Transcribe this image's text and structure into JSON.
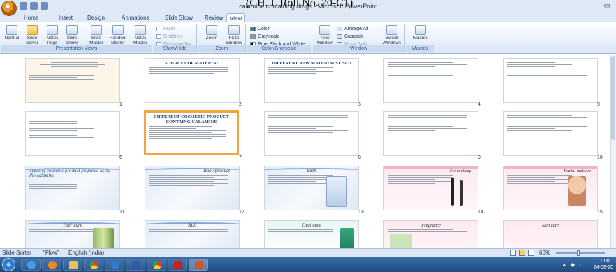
{
  "window": {
    "title": "calamine containing drugs - Microsoft PowerPoint",
    "overlay_caption": "(CH. L Roll No. 20-C1)",
    "minimize": "–",
    "maximize": "▭"
  },
  "tabs": [
    "Home",
    "Insert",
    "Design",
    "Animations",
    "Slide Show",
    "Review",
    "View"
  ],
  "ribbon": {
    "presentation_views": {
      "label": "Presentation Views",
      "buttons": [
        "Normal",
        "Slide Sorter",
        "Notes Page",
        "Slide Show",
        "Slide Master",
        "Handout Master",
        "Notes Master"
      ]
    },
    "show_hide": {
      "label": "Show/Hide",
      "items": [
        "Ruler",
        "Gridlines",
        "Message Bar"
      ]
    },
    "zoom": {
      "label": "Zoom",
      "buttons": [
        "Zoom",
        "Fit to Window"
      ]
    },
    "color": {
      "label": "Color/Grayscale",
      "items": [
        "Color",
        "Grayscale",
        "Pure Black and White"
      ]
    },
    "window": {
      "label": "Window",
      "new_window": "New Window",
      "items": [
        "Arrange All",
        "Cascade",
        "Move Split"
      ],
      "switch": "Switch Windows"
    },
    "macros": {
      "label": "Macros",
      "button": "Macros"
    }
  },
  "slides": [
    {
      "n": "1",
      "title": ""
    },
    {
      "n": "2",
      "title": "SOURCES OF MATERIAL"
    },
    {
      "n": "3",
      "title": "DIFFERENT RAW MATERIALS USED"
    },
    {
      "n": "4",
      "title": ""
    },
    {
      "n": "5",
      "title": ""
    },
    {
      "n": "6",
      "title": ""
    },
    {
      "n": "7",
      "title": "DIFFERENT COSMETIC PRODUCT CONTAING CALAMINE"
    },
    {
      "n": "8",
      "title": ""
    },
    {
      "n": "9",
      "title": ""
    },
    {
      "n": "10",
      "title": ""
    },
    {
      "n": "11",
      "title": "Types of cosmetic product prepared using the calamine"
    },
    {
      "n": "12",
      "title": "Baby product"
    },
    {
      "n": "13",
      "title": "Bath"
    },
    {
      "n": "14",
      "title": "Eye makeup"
    },
    {
      "n": "15",
      "title": "Facial makeup"
    },
    {
      "n": "",
      "title": "Hair care"
    },
    {
      "n": "",
      "title": "Nail"
    },
    {
      "n": "",
      "title": "Oral care"
    },
    {
      "n": "",
      "title": "Fragrance"
    },
    {
      "n": "",
      "title": "Skin care"
    }
  ],
  "status": {
    "view": "Slide Sorter",
    "theme": "\"Flow\"",
    "language": "English (India)",
    "zoom": "66%"
  },
  "taskbar": {
    "time": "11:00",
    "date": "24-08-20"
  }
}
